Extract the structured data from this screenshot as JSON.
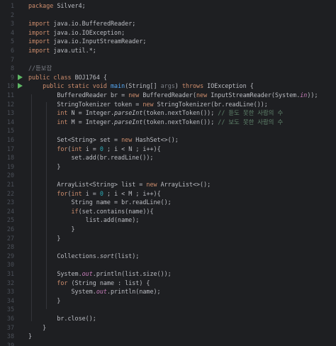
{
  "editor": {
    "language": "java",
    "lines": [
      {
        "n": "1",
        "tokens": [
          {
            "t": "package",
            "c": "kw"
          },
          {
            "t": " Silver4;",
            "c": ""
          }
        ]
      },
      {
        "n": "2",
        "tokens": []
      },
      {
        "n": "3",
        "tokens": [
          {
            "t": "import",
            "c": "kw"
          },
          {
            "t": " java.io.BufferedReader;",
            "c": ""
          }
        ]
      },
      {
        "n": "4",
        "tokens": [
          {
            "t": "import",
            "c": "kw"
          },
          {
            "t": " java.io.IOException;",
            "c": ""
          }
        ]
      },
      {
        "n": "5",
        "tokens": [
          {
            "t": "import",
            "c": "kw"
          },
          {
            "t": " java.io.InputStreamReader;",
            "c": ""
          }
        ]
      },
      {
        "n": "6",
        "tokens": [
          {
            "t": "import",
            "c": "kw"
          },
          {
            "t": " java.util.*;",
            "c": ""
          }
        ]
      },
      {
        "n": "7",
        "tokens": []
      },
      {
        "n": "8",
        "tokens": [
          {
            "t": "//듣보잡",
            "c": "cm"
          }
        ]
      },
      {
        "n": "9",
        "run": true,
        "tokens": [
          {
            "t": "public",
            "c": "kw"
          },
          {
            "t": " ",
            "c": ""
          },
          {
            "t": "class",
            "c": "kw"
          },
          {
            "t": " BOJ1764 {",
            "c": ""
          }
        ]
      },
      {
        "n": "10",
        "run": true,
        "tokens": [
          {
            "t": "    ",
            "c": ""
          },
          {
            "t": "public",
            "c": "kw"
          },
          {
            "t": " ",
            "c": ""
          },
          {
            "t": "static",
            "c": "kw"
          },
          {
            "t": " ",
            "c": ""
          },
          {
            "t": "void",
            "c": "kw"
          },
          {
            "t": " ",
            "c": ""
          },
          {
            "t": "main",
            "c": "fn"
          },
          {
            "t": "(String[] ",
            "c": ""
          },
          {
            "t": "args",
            "c": "par"
          },
          {
            "t": ") ",
            "c": ""
          },
          {
            "t": "throws",
            "c": "kw"
          },
          {
            "t": " IOException {",
            "c": ""
          }
        ]
      },
      {
        "n": "11",
        "tokens": [
          {
            "t": "        BufferedReader br = ",
            "c": ""
          },
          {
            "t": "new",
            "c": "kw"
          },
          {
            "t": " BufferedReader(",
            "c": ""
          },
          {
            "t": "new",
            "c": "kw"
          },
          {
            "t": " InputStreamReader(System.",
            "c": ""
          },
          {
            "t": "in",
            "c": "st"
          },
          {
            "t": "));",
            "c": ""
          }
        ]
      },
      {
        "n": "12",
        "tokens": [
          {
            "t": "        StringTokenizer token = ",
            "c": ""
          },
          {
            "t": "new",
            "c": "kw"
          },
          {
            "t": " StringTokenizer(br.readLine());",
            "c": ""
          }
        ]
      },
      {
        "n": "13",
        "tokens": [
          {
            "t": "        ",
            "c": ""
          },
          {
            "t": "int",
            "c": "kw"
          },
          {
            "t": " N = Integer.",
            "c": ""
          },
          {
            "t": "parseInt",
            "c": "it"
          },
          {
            "t": "(token.nextToken()); ",
            "c": ""
          },
          {
            "t": "// 듣도 못한 사람의 수",
            "c": "cmk"
          }
        ]
      },
      {
        "n": "14",
        "tokens": [
          {
            "t": "        ",
            "c": ""
          },
          {
            "t": "int",
            "c": "kw"
          },
          {
            "t": " M = Integer.",
            "c": ""
          },
          {
            "t": "parseInt",
            "c": "it"
          },
          {
            "t": "(token.nextToken()); ",
            "c": ""
          },
          {
            "t": "// 보도 못한 사람의 수",
            "c": "cmk"
          }
        ]
      },
      {
        "n": "15",
        "tokens": []
      },
      {
        "n": "16",
        "tokens": [
          {
            "t": "        Set<String> set = ",
            "c": ""
          },
          {
            "t": "new",
            "c": "kw"
          },
          {
            "t": " HashSet<>();",
            "c": ""
          }
        ]
      },
      {
        "n": "17",
        "tokens": [
          {
            "t": "        ",
            "c": ""
          },
          {
            "t": "for",
            "c": "kw"
          },
          {
            "t": "(",
            "c": ""
          },
          {
            "t": "int",
            "c": "kw"
          },
          {
            "t": " i = ",
            "c": ""
          },
          {
            "t": "0",
            "c": "num"
          },
          {
            "t": " ; i < N ; i++){",
            "c": ""
          }
        ]
      },
      {
        "n": "18",
        "tokens": [
          {
            "t": "            set.add(br.readLine());",
            "c": ""
          }
        ]
      },
      {
        "n": "19",
        "tokens": [
          {
            "t": "        }",
            "c": ""
          }
        ]
      },
      {
        "n": "20",
        "tokens": []
      },
      {
        "n": "21",
        "tokens": [
          {
            "t": "        ArrayList<String> list = ",
            "c": ""
          },
          {
            "t": "new",
            "c": "kw"
          },
          {
            "t": " ArrayList<>();",
            "c": ""
          }
        ]
      },
      {
        "n": "22",
        "tokens": [
          {
            "t": "        ",
            "c": ""
          },
          {
            "t": "for",
            "c": "kw"
          },
          {
            "t": "(",
            "c": ""
          },
          {
            "t": "int",
            "c": "kw"
          },
          {
            "t": " i = ",
            "c": ""
          },
          {
            "t": "0",
            "c": "num"
          },
          {
            "t": " ; i < M ; i++){",
            "c": ""
          }
        ]
      },
      {
        "n": "23",
        "tokens": [
          {
            "t": "            String name = br.readLine();",
            "c": ""
          }
        ]
      },
      {
        "n": "24",
        "tokens": [
          {
            "t": "            ",
            "c": ""
          },
          {
            "t": "if",
            "c": "kw"
          },
          {
            "t": "(set.contains(name)){",
            "c": ""
          }
        ]
      },
      {
        "n": "25",
        "tokens": [
          {
            "t": "                list.add(name);",
            "c": ""
          }
        ]
      },
      {
        "n": "26",
        "tokens": [
          {
            "t": "            }",
            "c": ""
          }
        ]
      },
      {
        "n": "27",
        "tokens": [
          {
            "t": "        }",
            "c": ""
          }
        ]
      },
      {
        "n": "28",
        "tokens": []
      },
      {
        "n": "29",
        "tokens": [
          {
            "t": "        Collections.",
            "c": ""
          },
          {
            "t": "sort",
            "c": "it"
          },
          {
            "t": "(list);",
            "c": ""
          }
        ]
      },
      {
        "n": "30",
        "tokens": []
      },
      {
        "n": "31",
        "tokens": [
          {
            "t": "        System.",
            "c": ""
          },
          {
            "t": "out",
            "c": "st"
          },
          {
            "t": ".println(list.size());",
            "c": ""
          }
        ]
      },
      {
        "n": "32",
        "tokens": [
          {
            "t": "        ",
            "c": ""
          },
          {
            "t": "for",
            "c": "kw"
          },
          {
            "t": " (String name : list) {",
            "c": ""
          }
        ]
      },
      {
        "n": "33",
        "tokens": [
          {
            "t": "            System.",
            "c": ""
          },
          {
            "t": "out",
            "c": "st"
          },
          {
            "t": ".println(name);",
            "c": ""
          }
        ]
      },
      {
        "n": "34",
        "tokens": [
          {
            "t": "        }",
            "c": ""
          }
        ]
      },
      {
        "n": "35",
        "tokens": []
      },
      {
        "n": "36",
        "tokens": [
          {
            "t": "        br.close();",
            "c": ""
          }
        ]
      },
      {
        "n": "37",
        "tokens": [
          {
            "t": "    }",
            "c": ""
          }
        ]
      },
      {
        "n": "38",
        "tokens": [
          {
            "t": "}",
            "c": ""
          }
        ]
      },
      {
        "n": "39",
        "tokens": []
      }
    ]
  },
  "colors": {
    "background": "#1e1f22",
    "keyword": "#cf8e6d",
    "function": "#56a8f5",
    "number": "#2aacb8",
    "comment": "#7a7e85",
    "static_field": "#c77dbb",
    "run_gutter_icon": "#5fb865"
  },
  "icons": {
    "gutter": "run-icon"
  }
}
